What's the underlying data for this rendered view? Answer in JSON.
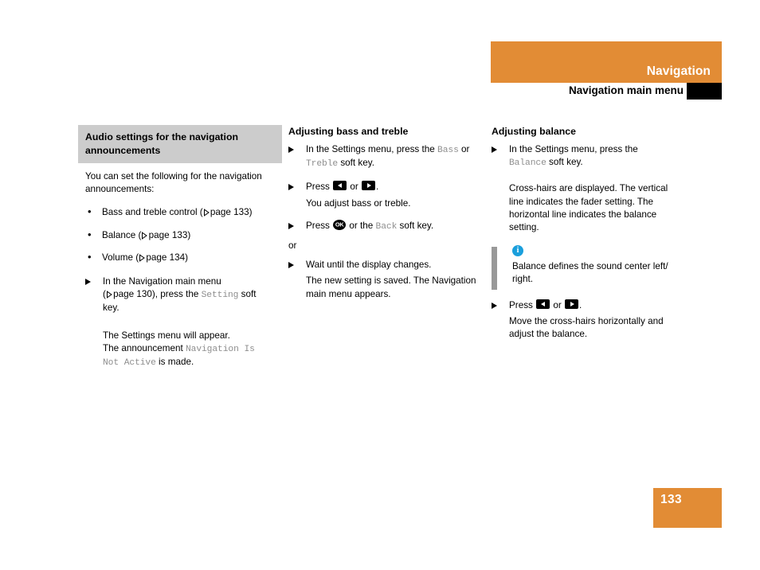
{
  "header": {
    "chapter": "Navigation",
    "section": "Navigation main menu",
    "accent_color": "#e28c35",
    "tab_color": "#000000"
  },
  "columns": {
    "left": {
      "heading": "Audio settings for the navigation announcements",
      "intro": "You can set the following for the navigation announcements:",
      "bullets": [
        {
          "text": "Bass and treble control (",
          "ref": " page 133)"
        },
        {
          "text": "Balance (",
          "ref": " page 133)"
        },
        {
          "text": "Volume (",
          "ref": " page 134)"
        }
      ],
      "step": {
        "line1": "In the Navigation main menu",
        "line2_pre": "(",
        "line2_ref": " page 130), press the ",
        "line2_code": "Setting",
        "line2_post": " soft key."
      },
      "result_line1": "The Settings menu will appear.",
      "result_line2_pre": "The announcement ",
      "result_line2_code": "Navigation Is Not Active",
      "result_line2_post": " is made."
    },
    "middle": {
      "heading": "Adjusting bass and treble",
      "step1_pre": "In the Settings menu, press the ",
      "step1_code1": "Bass",
      "step1_mid": " or ",
      "step1_code2": "Treble",
      "step1_post": " soft key.",
      "step2_press": "Press",
      "step2_or": "or",
      "step2_period": ".",
      "step2_result": "You adjust bass or treble.",
      "step3_press": "Press",
      "step3_ok_label": "OK",
      "step3_mid": "or the ",
      "step3_code": "Back",
      "step3_post": " soft key.",
      "or_label": "or",
      "step4": "Wait until the display changes.",
      "step4_result": "The new setting is saved. The Navigation main menu appears."
    },
    "right": {
      "heading": "Adjusting balance",
      "step1_pre": "In the Settings menu, press the",
      "step1_code": "Balance",
      "step1_post": " soft key.",
      "step1_result": "Cross-hairs are displayed. The vertical line indicates the fader setting. The horizontal line indicates the balance setting.",
      "note": {
        "icon": "info-icon",
        "icon_letter": "i",
        "text": "Balance defines the sound center left/ right.",
        "accent_color": "#1a9fdc",
        "bar_color": "#999999"
      },
      "step2_press": "Press",
      "step2_or": "or",
      "step2_period": ".",
      "step2_result": "Move the cross-hairs horizontally and adjust the balance."
    }
  },
  "footer": {
    "page_number": "133",
    "box_color": "#e28c35"
  }
}
